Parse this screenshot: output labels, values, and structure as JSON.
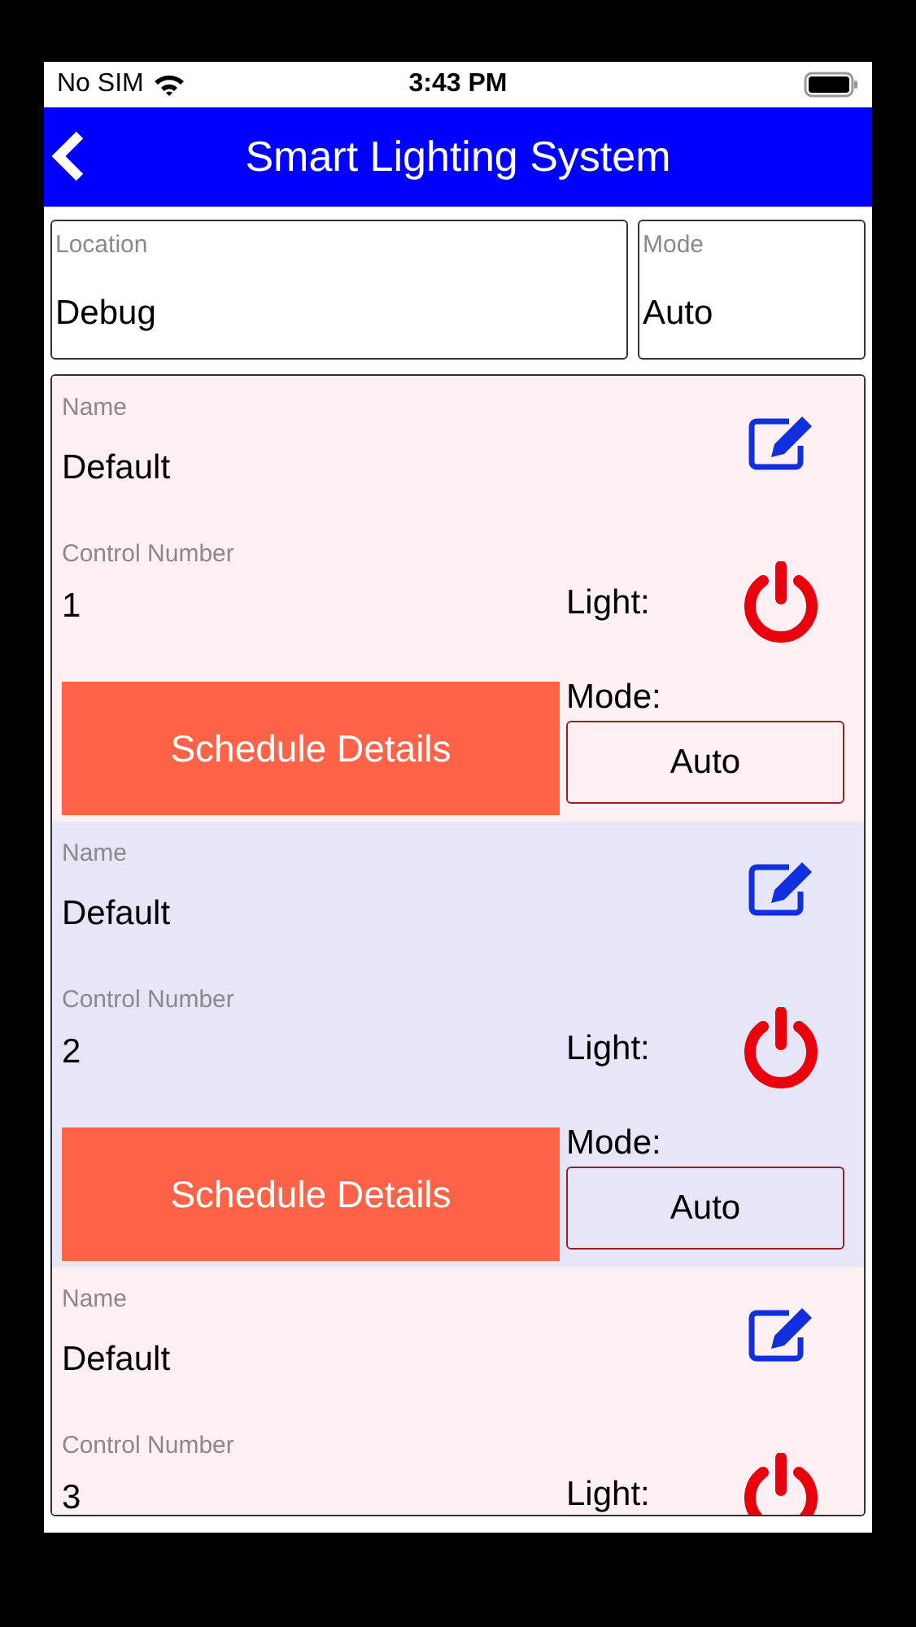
{
  "status_bar": {
    "carrier": "No SIM",
    "time": "3:43 PM"
  },
  "header": {
    "title": "Smart Lighting System"
  },
  "filters": [
    {
      "label": "Location",
      "value": "Debug"
    },
    {
      "label": "Mode",
      "value": "Auto"
    }
  ],
  "controllers": [
    {
      "color": "#fff0f3",
      "name_label": "Name",
      "name": "Default",
      "number_label": "Control Number",
      "number": "1",
      "light_label": "Light:",
      "schedule_button": "Schedule Details",
      "mode_label": "Mode:",
      "mode": "Auto"
    },
    {
      "color": "#e6e6f8",
      "name_label": "Name",
      "name": "Default",
      "number_label": "Control Number",
      "number": "2",
      "light_label": "Light:",
      "schedule_button": "Schedule Details",
      "mode_label": "Mode:",
      "mode": "Auto"
    },
    {
      "color": "#fff0f3",
      "name_label": "Name",
      "name": "Default",
      "number_label": "Control Number",
      "number": "3",
      "light_label": "Light:"
    }
  ]
}
